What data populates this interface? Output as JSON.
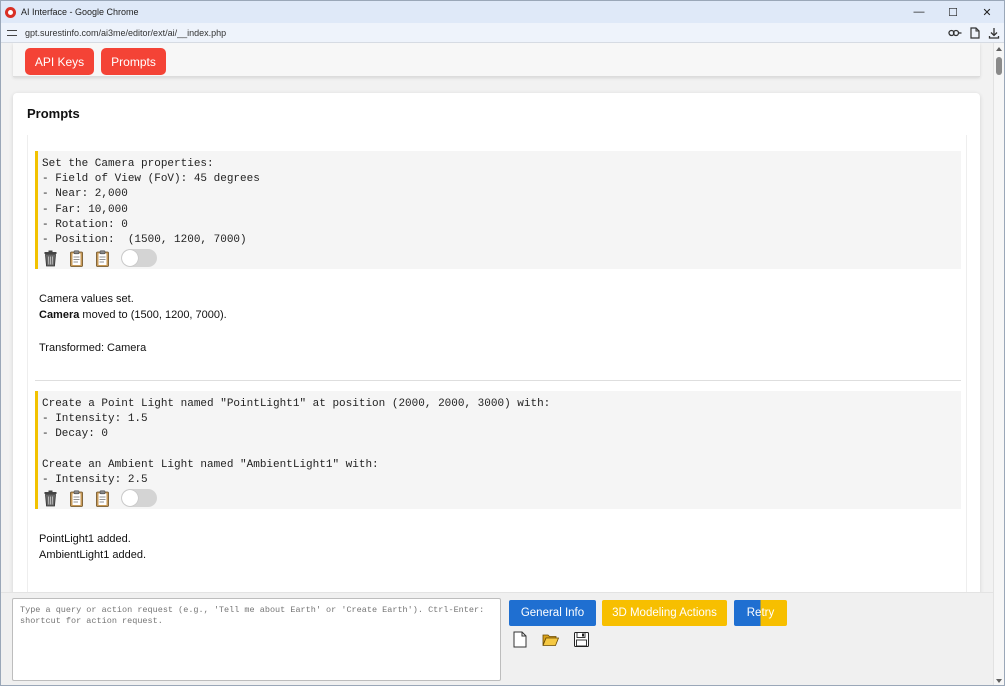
{
  "window": {
    "title": "AI Interface - Google Chrome",
    "controls": {
      "minimize": "—",
      "maximize": "☐",
      "close": "✕"
    }
  },
  "address": {
    "url": "gpt.surestinfo.com/ai3me/editor/ext/ai/__index.php"
  },
  "tabs": {
    "api_keys": "API Keys",
    "prompts": "Prompts"
  },
  "card": {
    "title": "Prompts"
  },
  "entries": [
    {
      "prompt": "Set the Camera properties:\n- Field of View (FoV): 45 degrees\n- Near: 2,000\n- Far: 10,000\n- Rotation: 0\n- Position:  (1500, 1200, 7000)",
      "response": {
        "line1": "Camera values set.",
        "line2_bold": "Camera",
        "line2_rest": " moved to (1500, 1200, 7000).",
        "line3": "Transformed: Camera"
      }
    },
    {
      "prompt": "Create a Point Light named \"PointLight1\" at position (2000, 2000, 3000) with:\n- Intensity: 1.5\n- Decay: 0\n\nCreate an Ambient Light named \"AmbientLight1\" with:\n- Intensity: 2.5",
      "response": {
        "line1": "PointLight1 added.",
        "line2": "AmbientLight1 added."
      }
    }
  ],
  "query": {
    "placeholder": "Type a query or action request (e.g., 'Tell me about Earth' or 'Create Earth'). Ctrl-Enter: shortcut for action request."
  },
  "buttons": {
    "general_info": "General Info",
    "modeling_actions": "3D Modeling Actions",
    "retry": "Retry"
  },
  "colors": {
    "tab_red": "#f44336",
    "button_blue": "#1f6fd1",
    "button_yellow": "#f7bf00",
    "prompt_accent": "#f2c200"
  }
}
